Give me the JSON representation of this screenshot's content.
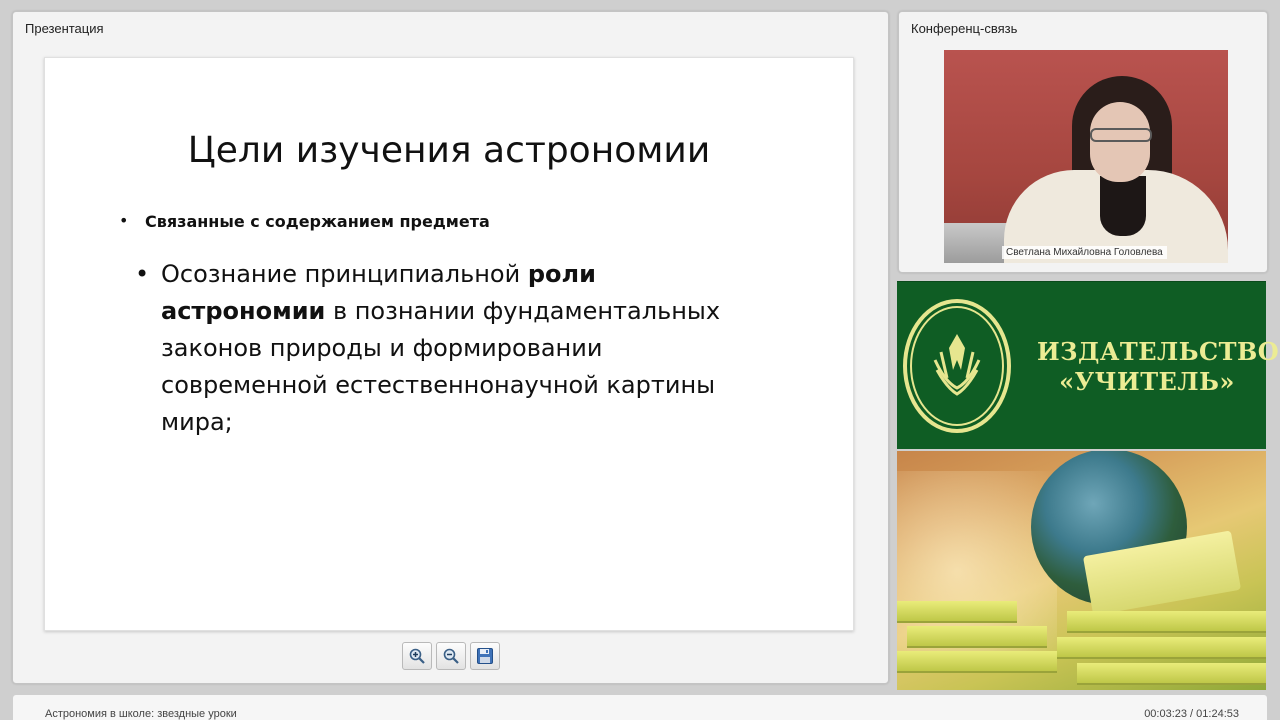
{
  "presentation": {
    "panel_title": "Презентация",
    "slide": {
      "title": "Цели изучения астрономии",
      "sub_bullet": "Связанные с содержанием предмета",
      "bullet_before": "Осознание принципиальной ",
      "bullet_bold": "роли астрономии",
      "bullet_after": " в познании фундаментальных законов природы и формировании современной естественнонаучной картины мира;",
      "bullet_glyph": "•"
    },
    "toolbar": {
      "zoom_in_icon": "zoom-in-icon",
      "zoom_out_icon": "zoom-out-icon",
      "save_icon": "save-icon"
    }
  },
  "conference": {
    "panel_title": "Конференц-связь",
    "participant_name": "Светлана Михайловна Головлева"
  },
  "publisher": {
    "name_line1": "ИЗДАТЕЛЬСТВО",
    "name_line2": "«УЧИТЕЛЬ»",
    "accent_color": "#ecec94",
    "background_color": "#0f5d24"
  },
  "footer": {
    "course_title": "Астрономия в школе: звездные уроки",
    "playback_time": "00:03:23 / 01:24:53"
  }
}
